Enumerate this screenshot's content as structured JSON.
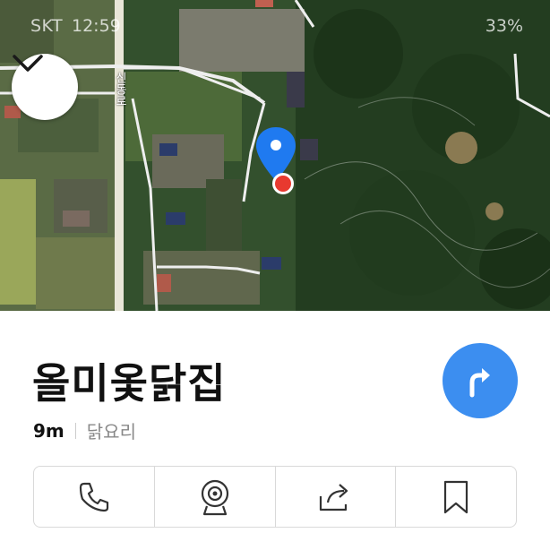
{
  "status_bar": {
    "carrier": "SKT",
    "time": "12:59",
    "right_text": "33%"
  },
  "map": {
    "road_label": "신동로",
    "collapse_icon": "chevron-down-icon"
  },
  "place": {
    "name": "올미옻닭집",
    "distance": "9m",
    "category": "닭요리"
  },
  "actions": {
    "items": [
      {
        "name": "call",
        "icon": "phone-icon"
      },
      {
        "name": "street-view",
        "icon": "camera-icon"
      },
      {
        "name": "share",
        "icon": "share-icon"
      },
      {
        "name": "save",
        "icon": "bookmark-icon"
      }
    ]
  },
  "colors": {
    "accent": "#3c8ef0",
    "pin": "#1f7af0",
    "marker": "#e8392f"
  }
}
